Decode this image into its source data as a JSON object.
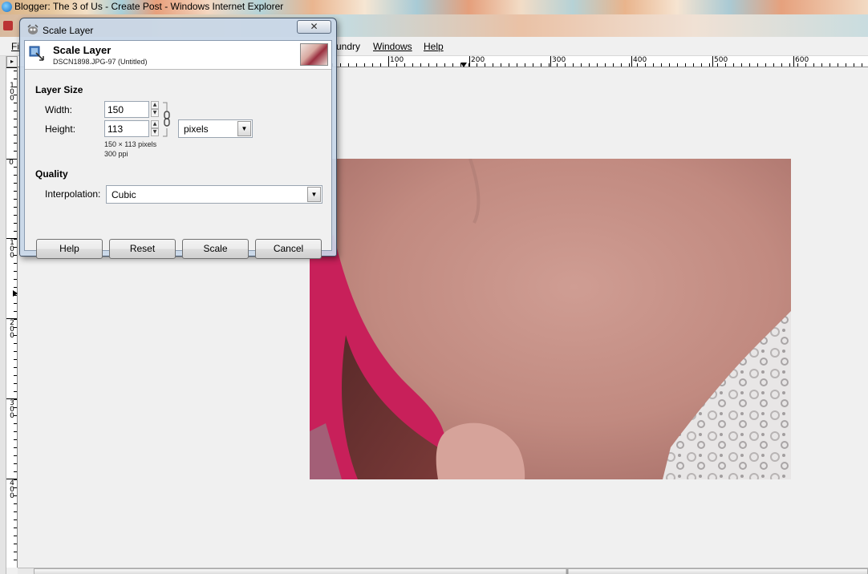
{
  "ie_window": {
    "title": "Blogger: The 3 of Us - Create Post - Windows Internet Explorer"
  },
  "gimp": {
    "menu": {
      "first_partial": "Fi",
      "laundry_partial": "undry",
      "windows": "Windows",
      "help": "Help"
    },
    "hruler_labels": [
      "100",
      "200",
      "300",
      "400",
      "500",
      "600"
    ],
    "vruler_labels": [
      "100",
      "0",
      "100",
      "200",
      "300",
      "400"
    ]
  },
  "dialog": {
    "title": "Scale Layer",
    "close_glyph": "✕",
    "header": {
      "title": "Scale Layer",
      "subtitle": "DSCN1898.JPG-97 (Untitled)"
    },
    "layer_size": {
      "section_label": "Layer Size",
      "width_label": "Width:",
      "width_value": "150",
      "height_label": "Height:",
      "height_value": "113",
      "unit_value": "pixels",
      "dimensions_note": "150 × 113 pixels",
      "resolution_note": "300 ppi"
    },
    "quality": {
      "section_label": "Quality",
      "interpolation_label": "Interpolation:",
      "interpolation_value": "Cubic"
    },
    "buttons": {
      "help": "Help",
      "reset": "Reset",
      "scale": "Scale",
      "cancel": "Cancel"
    }
  },
  "colors": {
    "dialog_frame": "#c8d7e8",
    "canvas_bg": "#f0f0f0",
    "photo_skin": "#c89488",
    "photo_pink": "#c8205a"
  }
}
